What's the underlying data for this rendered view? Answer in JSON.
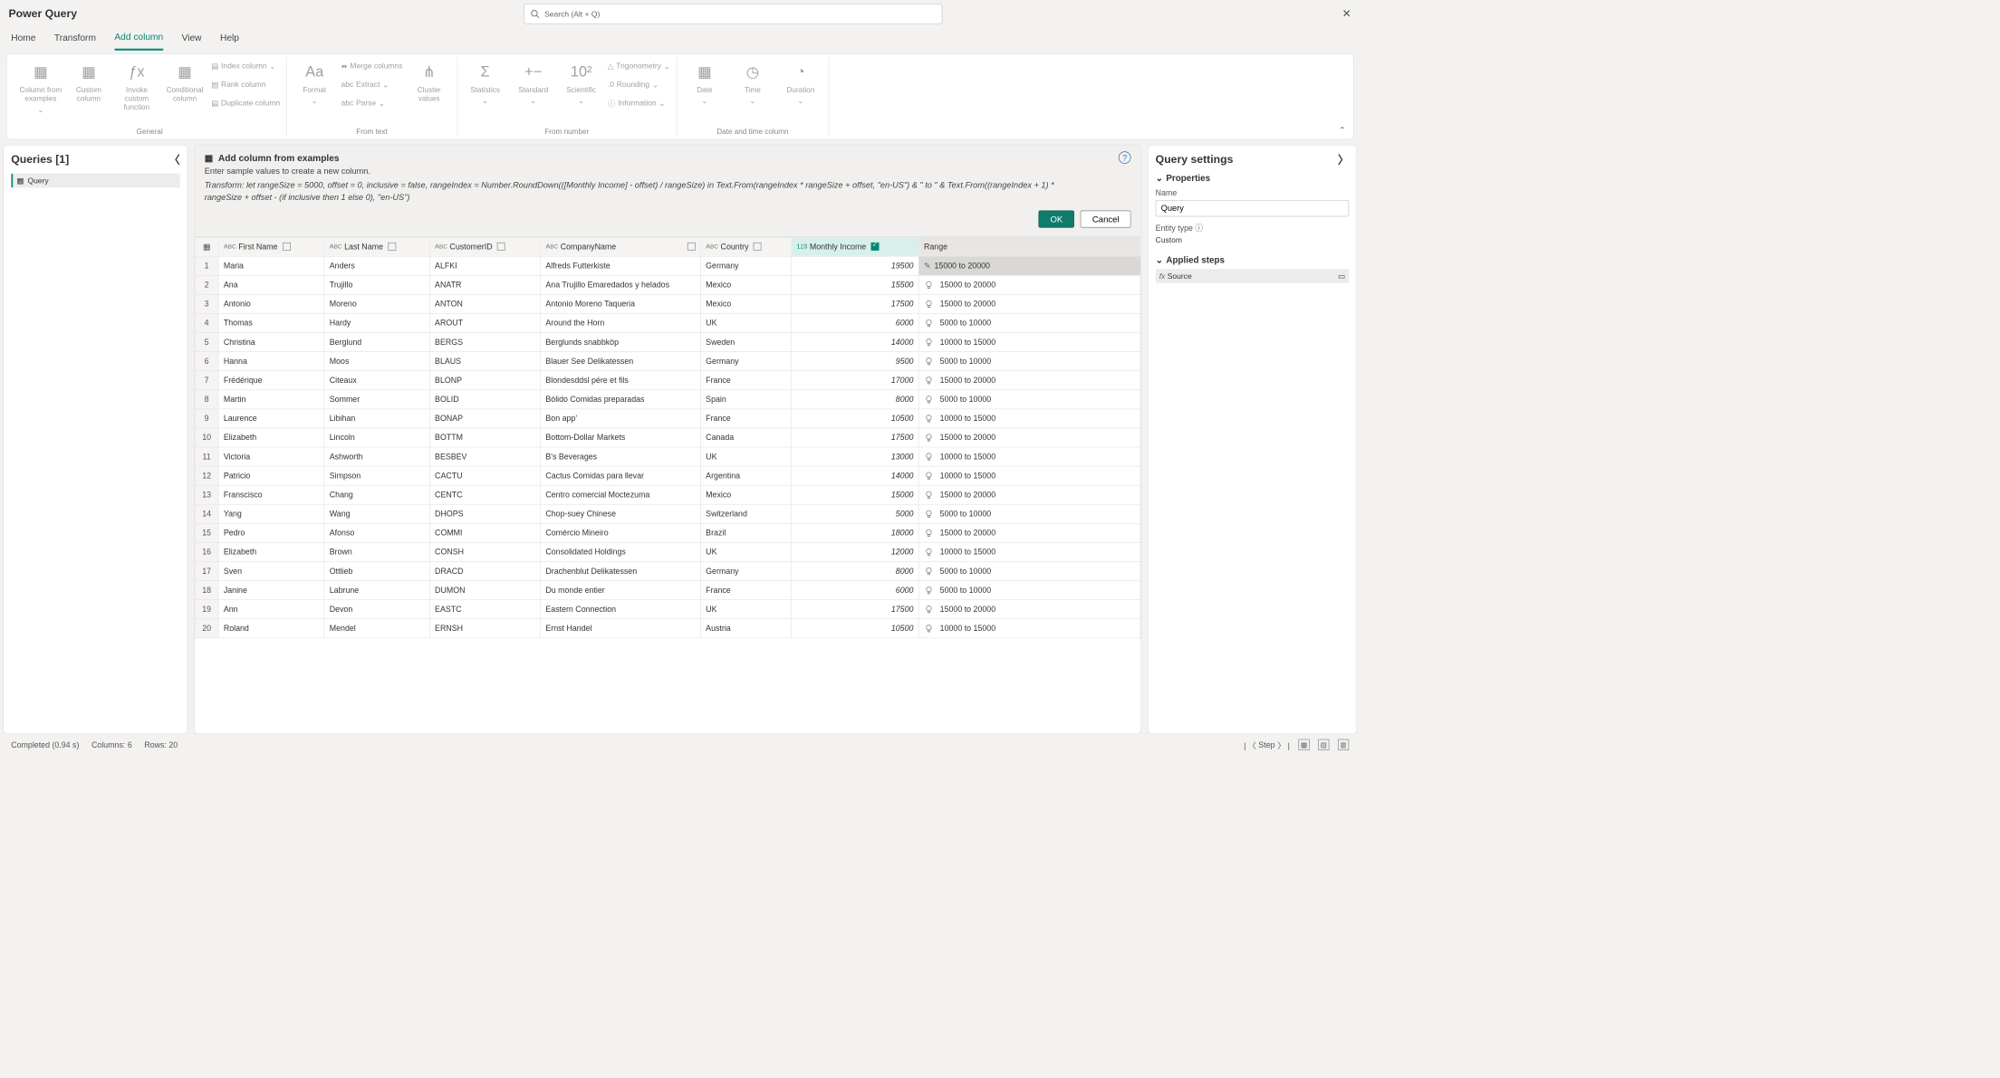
{
  "title": "Power Query",
  "search_placeholder": "Search (Alt + Q)",
  "tabs": {
    "home": "Home",
    "transform": "Transform",
    "add": "Add column",
    "view": "View",
    "help": "Help"
  },
  "ribbon": {
    "col_examples": "Column from examples",
    "custom_col": "Custom column",
    "invoke": "Invoke custom function",
    "conditional": "Conditional column",
    "index": "Index column",
    "rank": "Rank column",
    "duplicate": "Duplicate column",
    "format": "Format",
    "merge": "Merge columns",
    "extract": "Extract",
    "parse": "Parse",
    "cluster": "Cluster values",
    "statistics": "Statistics",
    "standard": "Standard",
    "scientific": "Scientific",
    "trig": "Trigonometry",
    "rounding": "Rounding",
    "info": "Information",
    "date": "Date",
    "time": "Time",
    "duration": "Duration",
    "g_general": "General",
    "g_text": "From text",
    "g_number": "From number",
    "g_date": "Date and time column"
  },
  "queries": {
    "header": "Queries [1]",
    "item": "Query"
  },
  "banner": {
    "title": "Add column from examples",
    "sub": "Enter sample values to create a new column.",
    "formula": "Transform: let rangeSize = 5000, offset = 0, inclusive = false, rangeIndex = Number.RoundDown(([Monthly Income] - offset) / rangeSize) in Text.From(rangeIndex * rangeSize + offset, \"en-US\") & \" to \" & Text.From((rangeIndex + 1) * rangeSize + offset - (if inclusive then 1 else 0), \"en-US\")",
    "ok": "OK",
    "cancel": "Cancel"
  },
  "columns": {
    "first": "First Name",
    "last": "Last Name",
    "cust": "CustomerID",
    "company": "CompanyName",
    "country": "Country",
    "income": "Monthly Income",
    "range": "Range"
  },
  "rows": [
    {
      "n": 1,
      "first": "Maria",
      "last": "Anders",
      "cust": "ALFKI",
      "company": "Alfreds Futterkiste",
      "country": "Germany",
      "income": 19500,
      "range": "15000 to 20000",
      "edit": true
    },
    {
      "n": 2,
      "first": "Ana",
      "last": "Trujillo",
      "cust": "ANATR",
      "company": "Ana Trujillo Emaredados y helados",
      "country": "Mexico",
      "income": 15500,
      "range": "15000 to 20000"
    },
    {
      "n": 3,
      "first": "Antonio",
      "last": "Moreno",
      "cust": "ANTON",
      "company": "Antonio Moreno Taqueria",
      "country": "Mexico",
      "income": 17500,
      "range": "15000 to 20000"
    },
    {
      "n": 4,
      "first": "Thomas",
      "last": "Hardy",
      "cust": "AROUT",
      "company": "Around the Horn",
      "country": "UK",
      "income": 6000,
      "range": "5000 to 10000"
    },
    {
      "n": 5,
      "first": "Christina",
      "last": "Berglund",
      "cust": "BERGS",
      "company": "Berglunds snabbköp",
      "country": "Sweden",
      "income": 14000,
      "range": "10000 to 15000"
    },
    {
      "n": 6,
      "first": "Hanna",
      "last": "Moos",
      "cust": "BLAUS",
      "company": "Blauer See Delikatessen",
      "country": "Germany",
      "income": 9500,
      "range": "5000 to 10000"
    },
    {
      "n": 7,
      "first": "Frédérique",
      "last": "Citeaux",
      "cust": "BLONP",
      "company": "Blondesddsl pére et fils",
      "country": "France",
      "income": 17000,
      "range": "15000 to 20000"
    },
    {
      "n": 8,
      "first": "Martin",
      "last": "Sommer",
      "cust": "BOLID",
      "company": "Bólido Comidas preparadas",
      "country": "Spain",
      "income": 8000,
      "range": "5000 to 10000"
    },
    {
      "n": 9,
      "first": "Laurence",
      "last": "Libihan",
      "cust": "BONAP",
      "company": "Bon app'",
      "country": "France",
      "income": 10500,
      "range": "10000 to 15000"
    },
    {
      "n": 10,
      "first": "Elizabeth",
      "last": "Lincoln",
      "cust": "BOTTM",
      "company": "Bottom-Dollar Markets",
      "country": "Canada",
      "income": 17500,
      "range": "15000 to 20000"
    },
    {
      "n": 11,
      "first": "Victoria",
      "last": "Ashworth",
      "cust": "BESBEV",
      "company": "B's Beverages",
      "country": "UK",
      "income": 13000,
      "range": "10000 to 15000"
    },
    {
      "n": 12,
      "first": "Patricio",
      "last": "Simpson",
      "cust": "CACTU",
      "company": "Cactus Comidas para llevar",
      "country": "Argentina",
      "income": 14000,
      "range": "10000 to 15000"
    },
    {
      "n": 13,
      "first": "Franscisco",
      "last": "Chang",
      "cust": "CENTC",
      "company": "Centro comercial Moctezuma",
      "country": "Mexico",
      "income": 15000,
      "range": "15000 to 20000"
    },
    {
      "n": 14,
      "first": "Yang",
      "last": "Wang",
      "cust": "DHOPS",
      "company": "Chop-suey Chinese",
      "country": "Switzerland",
      "income": 5000,
      "range": "5000 to 10000"
    },
    {
      "n": 15,
      "first": "Pedro",
      "last": "Afonso",
      "cust": "COMMI",
      "company": "Comércio Mineiro",
      "country": "Brazil",
      "income": 18000,
      "range": "15000 to 20000"
    },
    {
      "n": 16,
      "first": "Elizabeth",
      "last": "Brown",
      "cust": "CONSH",
      "company": "Consolidated Holdings",
      "country": "UK",
      "income": 12000,
      "range": "10000 to 15000"
    },
    {
      "n": 17,
      "first": "Sven",
      "last": "Ottlieb",
      "cust": "DRACD",
      "company": "Drachenblut Delikatessen",
      "country": "Germany",
      "income": 8000,
      "range": "5000 to 10000"
    },
    {
      "n": 18,
      "first": "Janine",
      "last": "Labrune",
      "cust": "DUMON",
      "company": "Du monde entier",
      "country": "France",
      "income": 6000,
      "range": "5000 to 10000"
    },
    {
      "n": 19,
      "first": "Ann",
      "last": "Devon",
      "cust": "EASTC",
      "company": "Eastern Connection",
      "country": "UK",
      "income": 17500,
      "range": "15000 to 20000"
    },
    {
      "n": 20,
      "first": "Roland",
      "last": "Mendel",
      "cust": "ERNSH",
      "company": "Ernst Handel",
      "country": "Austria",
      "income": 10500,
      "range": "10000 to 15000"
    }
  ],
  "settings": {
    "header": "Query settings",
    "properties": "Properties",
    "name_label": "Name",
    "name_value": "Query",
    "entity_label": "Entity type",
    "entity_value": "Custom",
    "applied": "Applied steps",
    "step1": "Source"
  },
  "status": {
    "completed": "Completed (0.94 s)",
    "cols": "Columns: 6",
    "rows": "Rows: 20",
    "step": "Step"
  }
}
